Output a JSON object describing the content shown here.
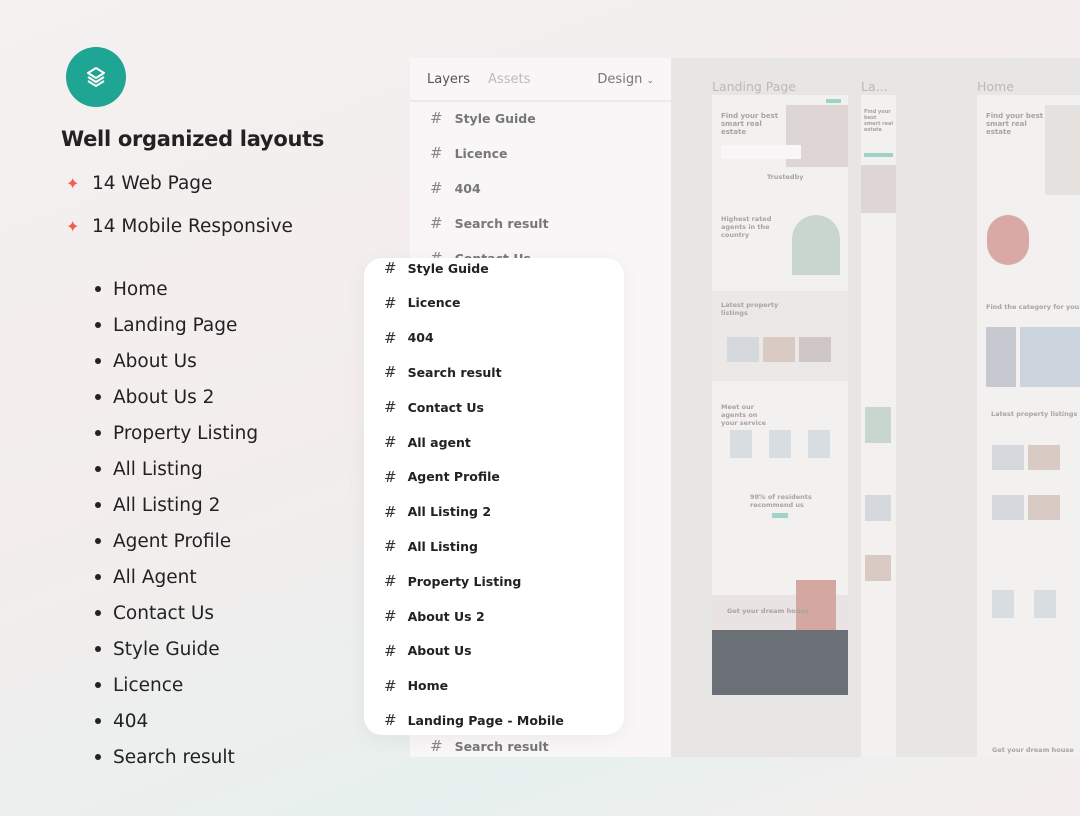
{
  "promo": {
    "icon": "layers-icon",
    "accent": "#1fa593",
    "star_color": "#f25c4a",
    "title": "Well organized layouts",
    "features": [
      "14 Web Page",
      "14 Mobile Responsive"
    ],
    "pages": [
      "Home",
      "Landing Page",
      "About Us",
      "About Us 2",
      "Property Listing",
      "All Listing",
      "All Listing 2",
      "Agent Profile",
      "All Agent",
      "Contact Us",
      "Style Guide",
      "Licence",
      "404",
      "Search result"
    ]
  },
  "panel": {
    "tabs": [
      "Layers",
      "Assets"
    ],
    "design_label": "Design",
    "layers": [
      "Style Guide",
      "Licence",
      "404",
      "Search result",
      "Contact Us"
    ],
    "bottom_layer": "Search result"
  },
  "popup": {
    "layers": [
      "Style Guide",
      "Licence",
      "404",
      "Search result",
      "Contact Us",
      "All agent",
      "Agent Profile",
      "All Listing 2",
      "All Listing",
      "Property Listing",
      "About Us 2",
      "About Us",
      "Home",
      "Landing Page - Mobile"
    ]
  },
  "canvas": {
    "frames": [
      {
        "label": "Landing Page",
        "hero": "Find your best smart real estate",
        "trusted": "Trustedby",
        "agents_heading": "Highest rated agents in the country",
        "listings_heading": "Latest property listings",
        "meet": "Meet our agents on your service",
        "recommend": "98% of residents recommend us",
        "dream": "Get your dream house"
      },
      {
        "label": "La...",
        "hero": "Find your best smart real estate"
      },
      {
        "label": "Home",
        "hero": "Find your best smart real estate",
        "category": "Find the category for you",
        "listings_heading": "Latest property listings",
        "dream": "Get your dream house"
      }
    ]
  }
}
